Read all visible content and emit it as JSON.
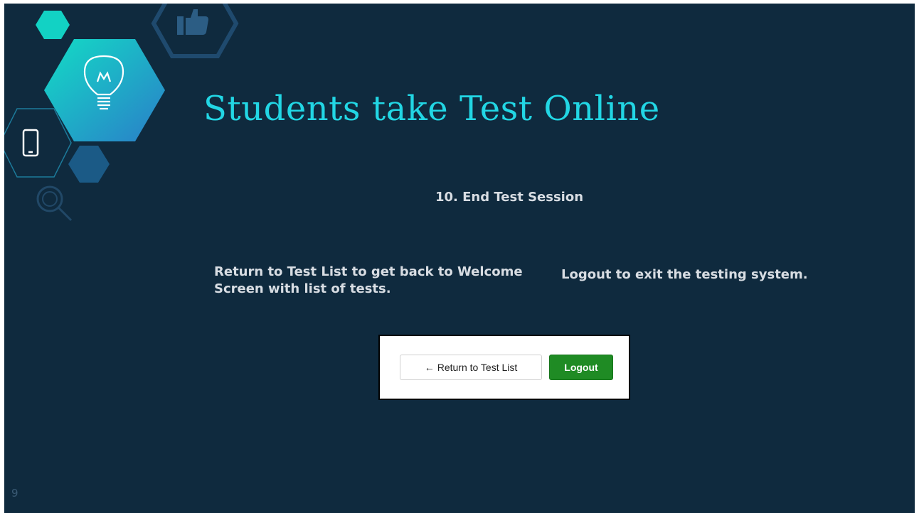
{
  "slide": {
    "title": "Students take Test Online",
    "subtitle": "10. End Test Session",
    "left_text": "Return to Test List to get back to Welcome Screen with list of tests.",
    "right_text": "Logout to exit the testing system.",
    "page_number": "9"
  },
  "screenshot": {
    "return_button_arrow": "←",
    "return_button_label": "Return to Test List",
    "logout_button_label": "Logout"
  },
  "decoration_icons": [
    "thumbs-up-icon",
    "lightbulb-icon",
    "smartphone-icon",
    "magnifier-icon"
  ],
  "colors": {
    "background": "#0f2a3e",
    "title": "#22d6e4",
    "body_text": "#d8dde3",
    "hexagon_teal": "#12d2c4",
    "hexagon_blue": "#1b5a86",
    "logout_button": "#1f8b24"
  }
}
